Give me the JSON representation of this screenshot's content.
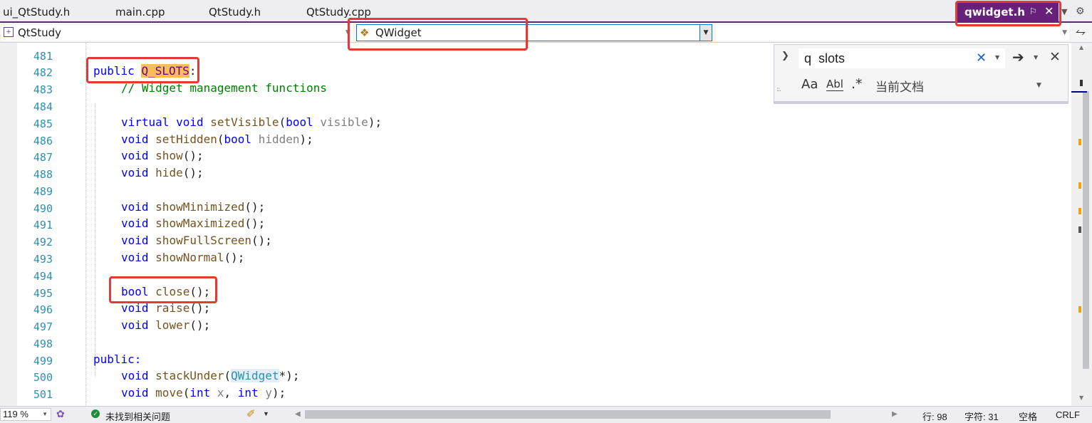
{
  "tabs": [
    {
      "label": "ui_QtStudy.h"
    },
    {
      "label": "main.cpp"
    },
    {
      "label": "QtStudy.h"
    },
    {
      "label": "QtStudy.cpp"
    }
  ],
  "active_tab": {
    "label": "qwidget.h"
  },
  "navbar": {
    "project": "QtStudy",
    "class_scope": "QWidget"
  },
  "find": {
    "query": "q  slots",
    "scope": "当前文档",
    "case_label": "Aa",
    "word_label": "Abl",
    "regex_label": ".*"
  },
  "lines": [
    {
      "num": "481"
    },
    {
      "num": "482"
    },
    {
      "num": "483"
    },
    {
      "num": "484"
    },
    {
      "num": "485"
    },
    {
      "num": "486"
    },
    {
      "num": "487"
    },
    {
      "num": "488"
    },
    {
      "num": "489"
    },
    {
      "num": "490"
    },
    {
      "num": "491"
    },
    {
      "num": "492"
    },
    {
      "num": "493"
    },
    {
      "num": "494"
    },
    {
      "num": "495"
    },
    {
      "num": "496"
    },
    {
      "num": "497"
    },
    {
      "num": "498"
    },
    {
      "num": "499"
    },
    {
      "num": "500"
    },
    {
      "num": "501"
    }
  ],
  "code": {
    "l482_public": "public",
    "l482_qslots": "Q_SLOTS",
    "l482_colon": ":",
    "l483": "// Widget management functions",
    "l485_kw": "virtual void",
    "l485_fn": "setVisible",
    "l485_t": "bool",
    "l485_p": "visible",
    "l486_kw": "void",
    "l486_fn": "setHidden",
    "l486_t": "bool",
    "l486_p": "hidden",
    "l487_kw": "void",
    "l487_fn": "show",
    "l488_kw": "void",
    "l488_fn": "hide",
    "l490_kw": "void",
    "l490_fn": "showMinimized",
    "l491_kw": "void",
    "l491_fn": "showMaximized",
    "l492_kw": "void",
    "l492_fn": "showFullScreen",
    "l493_kw": "void",
    "l493_fn": "showNormal",
    "l495_kw": "bool",
    "l495_fn": "close",
    "l496_kw": "void",
    "l496_fn": "raise",
    "l497_kw": "void",
    "l497_fn": "lower",
    "l499": "public:",
    "l500_kw": "void",
    "l500_fn": "stackUnder",
    "l500_ty": "QWidget",
    "l501_kw": "void",
    "l501_fn": "move",
    "l501_t1": "int",
    "l501_p1": "x",
    "l501_t2": "int",
    "l501_p2": "y"
  },
  "status": {
    "zoom": "119 %",
    "issues": "未找到相关问题",
    "line": "行: 98",
    "char": "字符: 31",
    "whitespace": "空格",
    "eol": "CRLF"
  },
  "colors": {
    "active_tab": "#68217a",
    "line_numbers": "#2b91af",
    "keyword": "#0000ff",
    "function": "#74531f",
    "comment": "#008000",
    "annotation_box": "#e53935",
    "find_highlight": "#f7be57"
  }
}
